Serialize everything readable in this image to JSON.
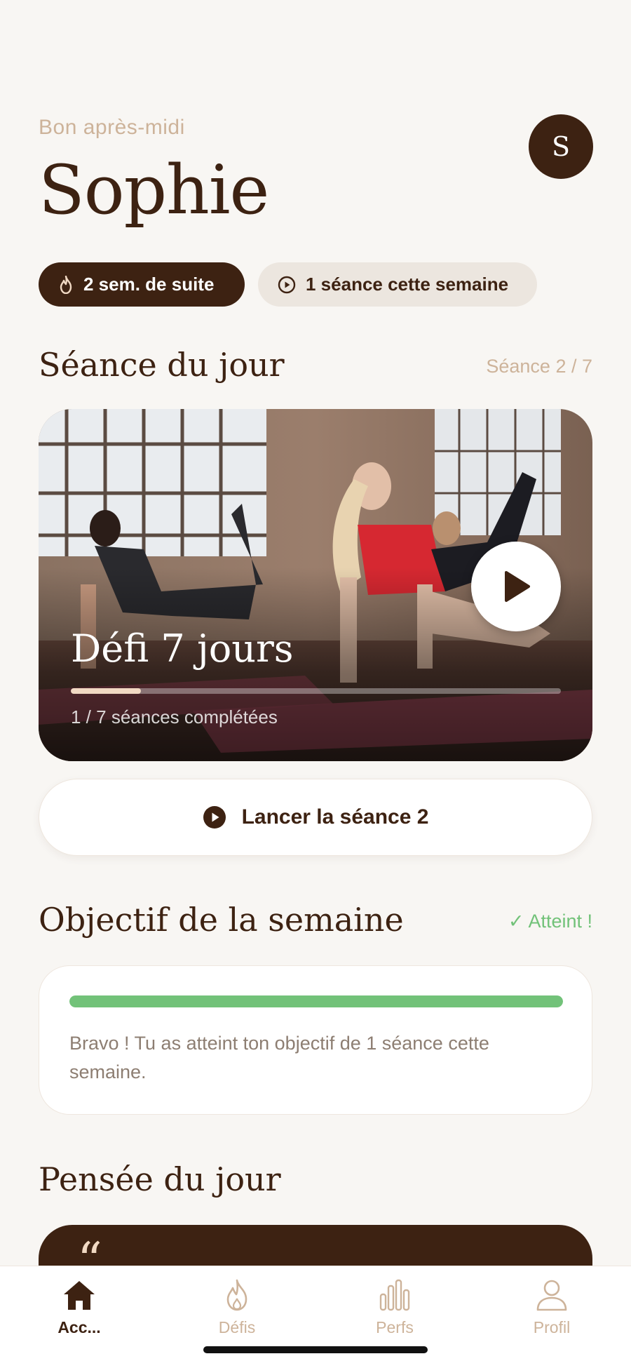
{
  "header": {
    "greeting": "Bon après-midi",
    "name": "Sophie",
    "avatar_initial": "S"
  },
  "pills": {
    "streak": "2 sem. de suite",
    "week": "1 séance cette semaine"
  },
  "today": {
    "title": "Séance du jour",
    "counter": "Séance 2 / 7",
    "card": {
      "title": "Défi 7 jours",
      "progress_fraction": 0.143,
      "caption": "1 / 7 séances complétées"
    },
    "launch_label": "Lancer la séance 2"
  },
  "goal": {
    "title": "Objectif de la semaine",
    "status": "✓ Atteint !",
    "progress_fraction": 1.0,
    "message": "Bravo ! Tu as atteint ton objectif de 1 séance cette semaine."
  },
  "thought": {
    "title": "Pensée du jour",
    "quote_mark": "“"
  },
  "tabs": [
    {
      "label": "Acc...",
      "icon": "home-icon",
      "active": true
    },
    {
      "label": "Défis",
      "icon": "flame-icon",
      "active": false
    },
    {
      "label": "Perfs",
      "icon": "bar-chart-icon",
      "active": false
    },
    {
      "label": "Profil",
      "icon": "profile-icon",
      "active": false
    }
  ],
  "colors": {
    "brand_brown": "#3d2212",
    "beige_text": "#cdb39a",
    "success_green": "#72c279",
    "background": "#f8f6f3"
  }
}
